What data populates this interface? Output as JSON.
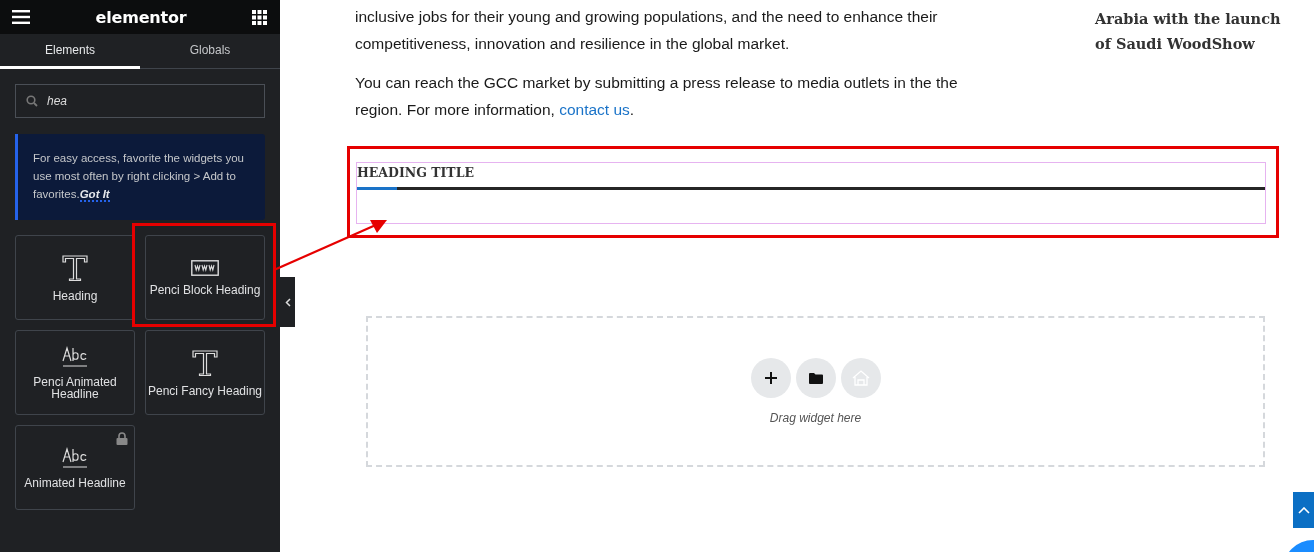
{
  "header": {
    "logo": "elementor"
  },
  "tabs": [
    {
      "label": "Elements",
      "selected": true
    },
    {
      "label": "Globals",
      "selected": false
    }
  ],
  "search": {
    "value": "hea"
  },
  "notice": {
    "text": "For easy access, favorite the widgets you use most often by right clicking > Add to favorites.",
    "link": "Got It"
  },
  "widgets": [
    {
      "label": "Heading",
      "kind": "title",
      "locked": false,
      "highlighted": false
    },
    {
      "label": "Penci Block Heading",
      "kind": "www",
      "locked": false,
      "highlighted": true
    },
    {
      "label": "Penci Animated Headline",
      "kind": "abc",
      "locked": false,
      "highlighted": false
    },
    {
      "label": "Penci Fancy Heading",
      "kind": "title",
      "locked": false,
      "highlighted": false
    },
    {
      "label": "Animated Headline",
      "kind": "abc",
      "locked": true,
      "highlighted": false
    }
  ],
  "article": {
    "paragraph_1": "inclusive jobs for their young and growing populations, and the need to enhance their competitiveness, innovation and resilience in the global market.",
    "paragraph_2": "You can reach the GCC market by submitting a press release to media outlets in the the region. For more information, ",
    "link": "contact us",
    "paragraph_2_end": "."
  },
  "side_headline": "Arabia with the launch of Saudi WoodShow",
  "heading_widget": {
    "title": "HEADING TITLE",
    "highlighted": true
  },
  "drop_zone": {
    "hint": "Drag widget here"
  }
}
